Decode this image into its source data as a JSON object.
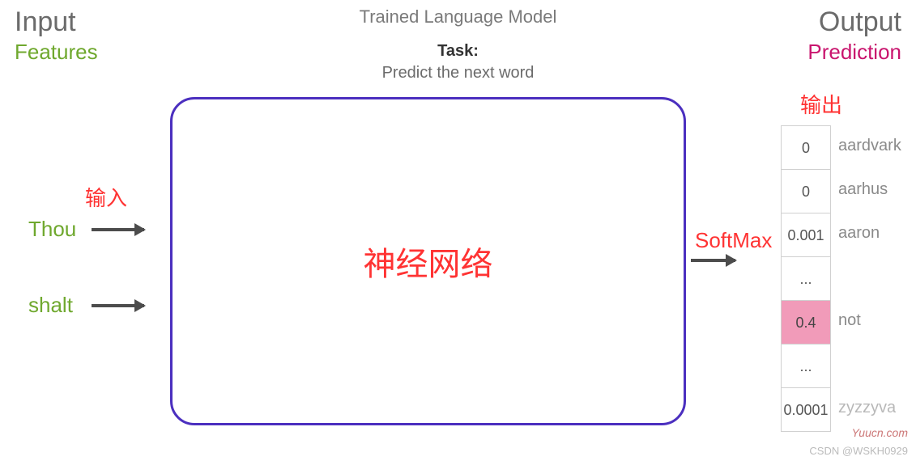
{
  "input": {
    "title": "Input",
    "subtitle": "Features"
  },
  "center": {
    "title": "Trained Language Model",
    "task_label": "Task:",
    "task_desc": "Predict the next word"
  },
  "output": {
    "title": "Output",
    "subtitle": "Prediction"
  },
  "nn": {
    "label": "神经网络"
  },
  "words": {
    "w1": "Thou",
    "w2": "shalt"
  },
  "annotations": {
    "input": "输入",
    "softmax": "SoftMax",
    "output": "输出"
  },
  "table": {
    "rows": [
      {
        "value": "0",
        "label": "aardvark"
      },
      {
        "value": "0",
        "label": "aarhus"
      },
      {
        "value": "0.001",
        "label": "aaron"
      },
      {
        "value": "...",
        "label": ""
      },
      {
        "value": "0.4",
        "label": "not",
        "highlight": true
      },
      {
        "value": "...",
        "label": ""
      },
      {
        "value": "0.0001",
        "label": "zyzzyva"
      }
    ]
  },
  "watermark": {
    "w1": "Yuucn.com",
    "w2": "CSDN @WSKH0929"
  }
}
